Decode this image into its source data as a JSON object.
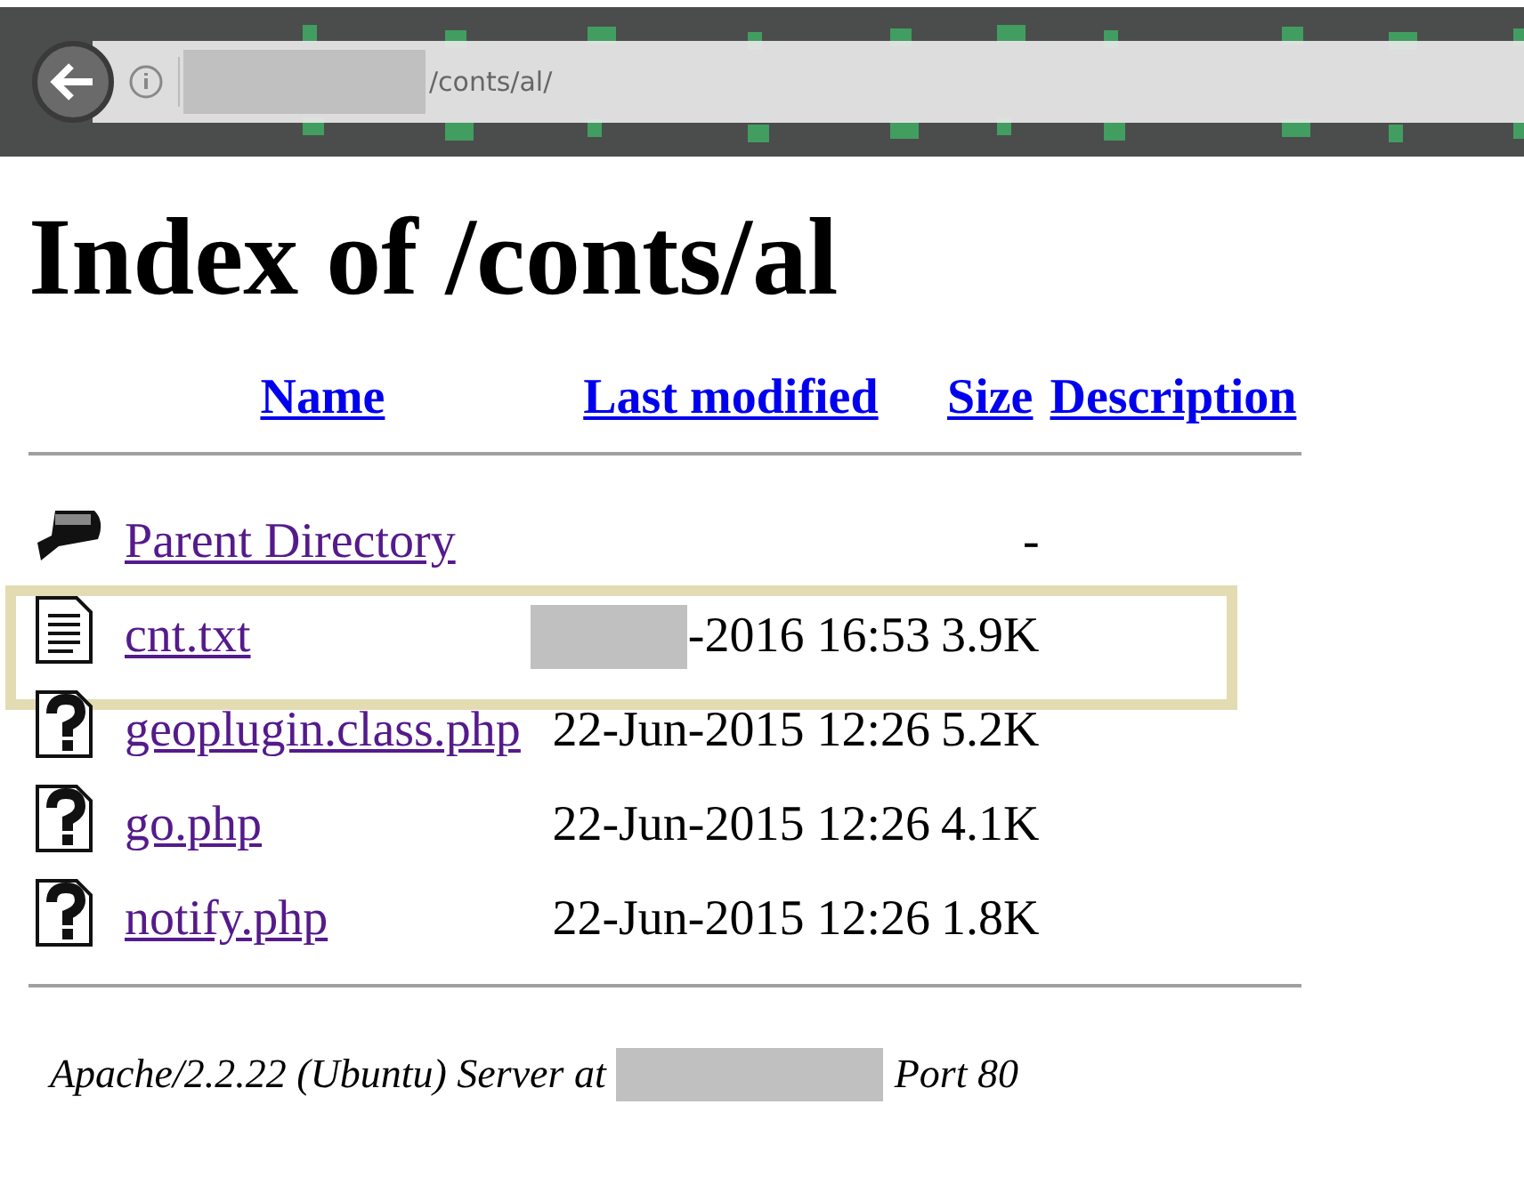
{
  "address_bar": {
    "url": "/conts/al/",
    "redacted": true
  },
  "title": "Index of /conts/al",
  "columns": [
    "Name",
    "Last modified",
    "Size",
    "Description"
  ],
  "rows": [
    {
      "kind": "parent",
      "name": "Parent Directory",
      "size": "-",
      "highlighted": false,
      "redacted": false
    },
    {
      "kind": "text",
      "name": "cnt.txt",
      "modified": "-2016 16:53",
      "size": "3.9K",
      "highlighted": true,
      "redacted": true
    },
    {
      "kind": "unknown",
      "name": "geoplugin.class.php",
      "modified": "22-Jun-2015 12:26",
      "size": "5.2K",
      "highlighted": false,
      "redacted": false
    },
    {
      "kind": "unknown",
      "name": "go.php",
      "modified": "22-Jun-2015 12:26",
      "size": "4.1K",
      "highlighted": false,
      "redacted": false
    },
    {
      "kind": "unknown",
      "name": "notify.php",
      "modified": "22-Jun-2015 12:26",
      "size": "1.8K",
      "highlighted": false,
      "redacted": false
    }
  ],
  "footer": {
    "text": "Apache/2.2.22 (Ubuntu) Server at",
    "redacted": true,
    "port": "Port 80"
  }
}
